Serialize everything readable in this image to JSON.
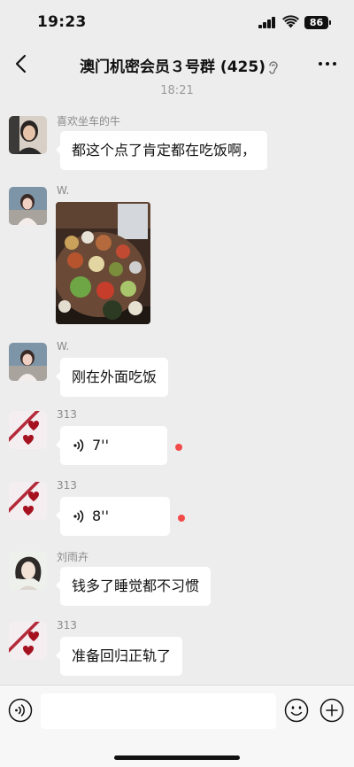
{
  "status": {
    "time": "19:23",
    "battery": "86"
  },
  "header": {
    "title": "澳门机密会员３号群 (425)"
  },
  "timestamp": "18:21",
  "messages": [
    {
      "sender": "喜欢坐车的牛",
      "type": "text",
      "text": "都这个点了肯定都在吃饭啊，"
    },
    {
      "sender": "W.",
      "type": "image"
    },
    {
      "sender": "W.",
      "type": "text",
      "text": "刚在外面吃饭"
    },
    {
      "sender": "313",
      "type": "voice",
      "duration": "7''"
    },
    {
      "sender": "313",
      "type": "voice",
      "duration": "8''"
    },
    {
      "sender": "刘雨卉",
      "type": "text",
      "text": "钱多了睡觉都不习惯"
    },
    {
      "sender": "313",
      "type": "text",
      "text": "准备回归正轨了"
    }
  ],
  "input": {
    "placeholder": ""
  },
  "colors": {
    "background": "#EDEDED",
    "bubble": "#FFFFFF",
    "unread": "#F34A4A"
  },
  "icons": [
    "back-arrow-icon",
    "ear-icon",
    "more-icon",
    "voice-wave-icon",
    "voice-mode-icon",
    "emoji-icon",
    "plus-icon"
  ]
}
